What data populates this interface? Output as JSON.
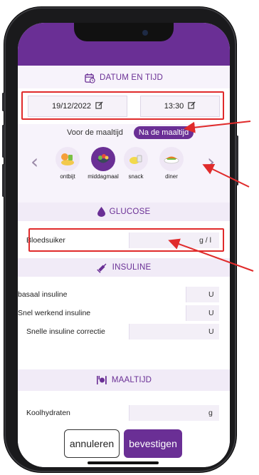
{
  "sections": {
    "datetime": "DATUM EN TIJD",
    "glucose": "GLUCOSE",
    "insulin": "INSULINE",
    "meal": "MAALTIJD"
  },
  "datetime": {
    "date": "19/12/2022",
    "time": "13:30"
  },
  "toggle": {
    "before": "Voor de maaltijd",
    "after": "Na de maaltijd",
    "selected": "after"
  },
  "meals": [
    {
      "label": "ontbijt",
      "icon": "breakfast-icon",
      "selected": false
    },
    {
      "label": "middagmaal",
      "icon": "salad-icon",
      "selected": true
    },
    {
      "label": "snack",
      "icon": "snack-icon",
      "selected": false
    },
    {
      "label": "diner",
      "icon": "dinner-icon",
      "selected": false
    }
  ],
  "glucose": {
    "label": "Bloedsuiker",
    "value": "",
    "unit": "g / l"
  },
  "insulin": [
    {
      "label": "basaal insuline",
      "value": "",
      "unit": "U"
    },
    {
      "label": "Snel werkend insuline",
      "value": "",
      "unit": "U"
    },
    {
      "label": "Snelle insuline correctie",
      "value": "",
      "unit": "U"
    }
  ],
  "meal": {
    "label": "Koolhydraten",
    "value": "",
    "unit": "g"
  },
  "actions": {
    "cancel": "annuleren",
    "confirm": "bevestigen"
  },
  "colors": {
    "accent": "#6a2f95",
    "highlight": "#e02b2b",
    "background": "#f7f3fb"
  }
}
